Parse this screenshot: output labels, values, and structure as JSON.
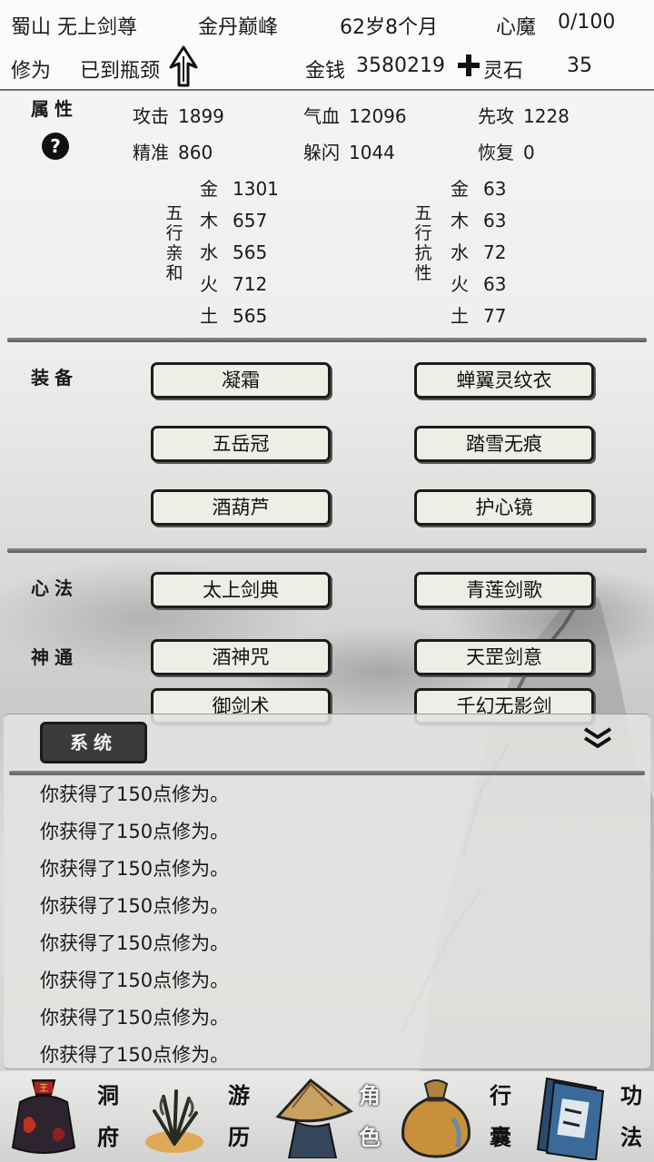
{
  "header": {
    "location": "蜀山 无上剑尊",
    "realm": "金丹巅峰",
    "age": "62岁8个月",
    "demon_label": "心魔",
    "demon_value": "0/100",
    "cultivation_label": "修为",
    "cultivation_value": "已到瓶颈",
    "money_label": "金钱",
    "money_value": "3580219",
    "stone_label": "灵石",
    "stone_value": "35"
  },
  "attributes": {
    "title": "属性",
    "help": "?",
    "stats": [
      {
        "label": "攻击",
        "value": "1899"
      },
      {
        "label": "气血",
        "value": "12096"
      },
      {
        "label": "先攻",
        "value": "1228"
      },
      {
        "label": "精准",
        "value": "860"
      },
      {
        "label": "躲闪",
        "value": "1044"
      },
      {
        "label": "恢复",
        "value": "0"
      }
    ],
    "affinity_label": [
      "五",
      "行",
      "亲",
      "和"
    ],
    "resist_label": [
      "五",
      "行",
      "抗",
      "性"
    ],
    "affinity": [
      {
        "el": "金",
        "value": "1301"
      },
      {
        "el": "木",
        "value": "657"
      },
      {
        "el": "水",
        "value": "565"
      },
      {
        "el": "火",
        "value": "712"
      },
      {
        "el": "土",
        "value": "565"
      }
    ],
    "resist": [
      {
        "el": "金",
        "value": "63"
      },
      {
        "el": "木",
        "value": "63"
      },
      {
        "el": "水",
        "value": "72"
      },
      {
        "el": "火",
        "value": "63"
      },
      {
        "el": "土",
        "value": "77"
      }
    ]
  },
  "equipment": {
    "title": "装备",
    "items": [
      "凝霜",
      "蝉翼灵纹衣",
      "五岳冠",
      "踏雪无痕",
      "酒葫芦",
      "护心镜"
    ]
  },
  "xinfa": {
    "title": "心法",
    "items": [
      "太上剑典",
      "青莲剑歌"
    ]
  },
  "shentong": {
    "title": "神通",
    "items": [
      "酒神咒",
      "天罡剑意",
      "御剑术",
      "千幻无影剑"
    ]
  },
  "log": {
    "tab": "系统",
    "lines": [
      "你获得了150点修为。",
      "你获得了150点修为。",
      "你获得了150点修为。",
      "你获得了150点修为。",
      "你获得了150点修为。",
      "你获得了150点修为。",
      "你获得了150点修为。",
      "你获得了150点修为。"
    ]
  },
  "nav": [
    {
      "icon": "bag-icon",
      "label": [
        "洞",
        "府"
      ]
    },
    {
      "icon": "herb-icon",
      "label": [
        "游",
        "历"
      ]
    },
    {
      "icon": "hat-icon",
      "label": [
        "角",
        "色"
      ]
    },
    {
      "icon": "pouch-icon",
      "label": [
        "行",
        "囊"
      ]
    },
    {
      "icon": "book-icon",
      "label": [
        "功",
        "法"
      ]
    }
  ]
}
